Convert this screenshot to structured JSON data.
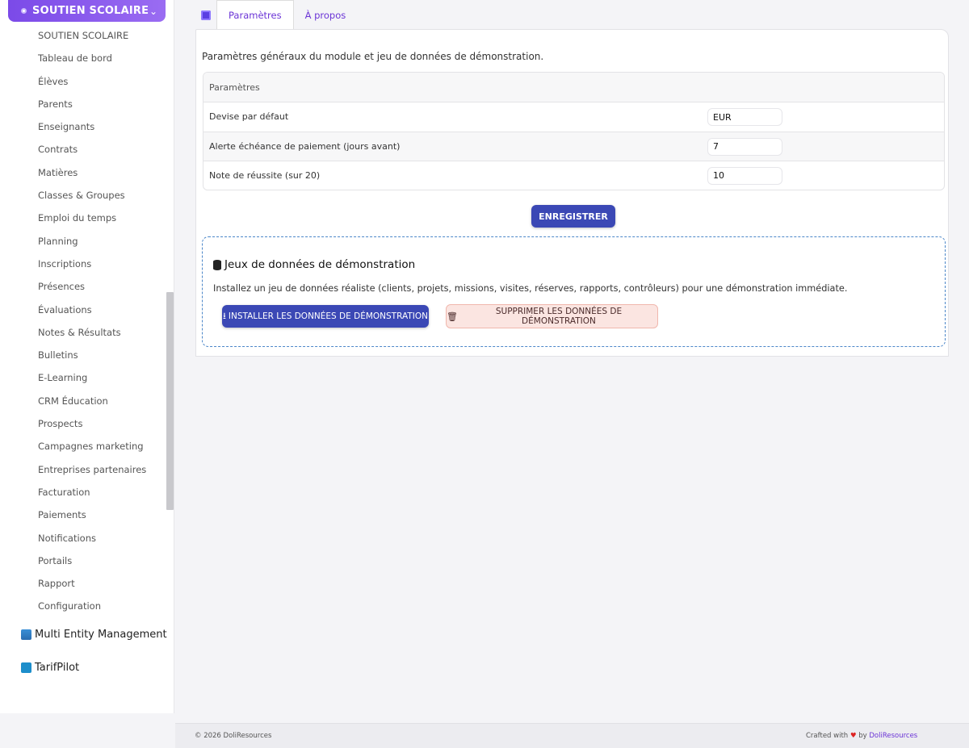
{
  "sidebar": {
    "module_title": "SOUTIEN SCOLAIRE",
    "items": [
      {
        "label": "SOUTIEN SCOLAIRE"
      },
      {
        "label": "Tableau de bord"
      },
      {
        "label": "Élèves"
      },
      {
        "label": "Parents"
      },
      {
        "label": "Enseignants"
      },
      {
        "label": "Contrats"
      },
      {
        "label": "Matières"
      },
      {
        "label": "Classes & Groupes"
      },
      {
        "label": "Emploi du temps"
      },
      {
        "label": "Planning"
      },
      {
        "label": "Inscriptions"
      },
      {
        "label": "Présences"
      },
      {
        "label": "Évaluations"
      },
      {
        "label": "Notes & Résultats"
      },
      {
        "label": "Bulletins"
      },
      {
        "label": "E-Learning"
      },
      {
        "label": "CRM Éducation"
      },
      {
        "label": "Prospects"
      },
      {
        "label": "Campagnes marketing"
      },
      {
        "label": "Entreprises partenaires"
      },
      {
        "label": "Facturation"
      },
      {
        "label": "Paiements"
      },
      {
        "label": "Notifications"
      },
      {
        "label": "Portails"
      },
      {
        "label": "Rapport"
      },
      {
        "label": "Configuration"
      }
    ],
    "other_modules": [
      {
        "label": "Multi Entity Management"
      },
      {
        "label": "TarifPilot"
      }
    ]
  },
  "tabs": [
    {
      "label": "Paramètres",
      "active": true
    },
    {
      "label": "À propos",
      "active": false
    }
  ],
  "main": {
    "intro": "Paramètres généraux du module et jeu de données de démonstration.",
    "table_header": "Paramètres",
    "params": [
      {
        "label": "Devise par défaut",
        "value": "EUR"
      },
      {
        "label": "Alerte échéance de paiement (jours avant)",
        "value": "7"
      },
      {
        "label": "Note de réussite (sur 20)",
        "value": "10"
      }
    ],
    "save_label": "ENREGISTRER",
    "demo": {
      "title": "Jeux de données de démonstration",
      "description": "Installez un jeu de données réaliste (clients, projets, missions, visites, réserves, rapports, contrôleurs) pour une démonstration immédiate.",
      "install_label": "INSTALLER LES DONNÉES DE DÉMONSTRATION",
      "delete_label": "SUPPRIMER LES DONNÉES DE DÉMONSTRATION"
    }
  },
  "footer": {
    "copyright": "© 2026 DoliResources",
    "crafted_prefix": "Crafted with",
    "crafted_by": "by",
    "crafted_link": "DoliResources"
  },
  "colors": {
    "accent": "#3b48b5",
    "brand_purple": "#7b4ae8",
    "link": "#6b34d6"
  }
}
